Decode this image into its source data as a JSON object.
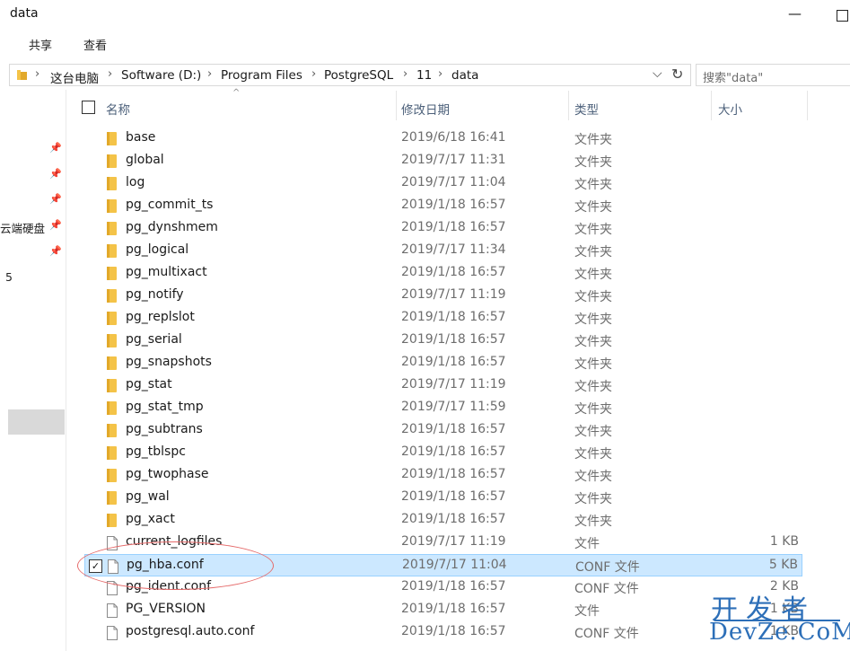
{
  "window": {
    "title": "data",
    "minimize_glyph": "—",
    "maximize_glyph": ""
  },
  "ribbon": {
    "tabs": [
      "共享",
      "查看"
    ]
  },
  "address": {
    "crumbs": [
      "这台电脑",
      "Software (D:)",
      "Program Files",
      "PostgreSQL",
      "11",
      "data"
    ],
    "separator": "›",
    "dropdown_glyph": "⌵",
    "refresh_glyph": "↻"
  },
  "search": {
    "placeholder": "搜索\"data\""
  },
  "nav": {
    "label1": "云端硬盘",
    "label2": "5",
    "pin_glyph": "📌"
  },
  "columns": {
    "name": "名称",
    "date": "修改日期",
    "type": "类型",
    "size": "大小",
    "sort_caret": "^"
  },
  "rows": [
    {
      "name": "base",
      "date": "2019/6/18 16:41",
      "type": "文件夹",
      "size": "",
      "kind": "folder"
    },
    {
      "name": "global",
      "date": "2019/7/17 11:31",
      "type": "文件夹",
      "size": "",
      "kind": "folder"
    },
    {
      "name": "log",
      "date": "2019/7/17 11:04",
      "type": "文件夹",
      "size": "",
      "kind": "folder"
    },
    {
      "name": "pg_commit_ts",
      "date": "2019/1/18 16:57",
      "type": "文件夹",
      "size": "",
      "kind": "folder"
    },
    {
      "name": "pg_dynshmem",
      "date": "2019/1/18 16:57",
      "type": "文件夹",
      "size": "",
      "kind": "folder"
    },
    {
      "name": "pg_logical",
      "date": "2019/7/17 11:34",
      "type": "文件夹",
      "size": "",
      "kind": "folder"
    },
    {
      "name": "pg_multixact",
      "date": "2019/1/18 16:57",
      "type": "文件夹",
      "size": "",
      "kind": "folder"
    },
    {
      "name": "pg_notify",
      "date": "2019/7/17 11:19",
      "type": "文件夹",
      "size": "",
      "kind": "folder"
    },
    {
      "name": "pg_replslot",
      "date": "2019/1/18 16:57",
      "type": "文件夹",
      "size": "",
      "kind": "folder"
    },
    {
      "name": "pg_serial",
      "date": "2019/1/18 16:57",
      "type": "文件夹",
      "size": "",
      "kind": "folder"
    },
    {
      "name": "pg_snapshots",
      "date": "2019/1/18 16:57",
      "type": "文件夹",
      "size": "",
      "kind": "folder"
    },
    {
      "name": "pg_stat",
      "date": "2019/7/17 11:19",
      "type": "文件夹",
      "size": "",
      "kind": "folder"
    },
    {
      "name": "pg_stat_tmp",
      "date": "2019/7/17 11:59",
      "type": "文件夹",
      "size": "",
      "kind": "folder"
    },
    {
      "name": "pg_subtrans",
      "date": "2019/1/18 16:57",
      "type": "文件夹",
      "size": "",
      "kind": "folder"
    },
    {
      "name": "pg_tblspc",
      "date": "2019/1/18 16:57",
      "type": "文件夹",
      "size": "",
      "kind": "folder"
    },
    {
      "name": "pg_twophase",
      "date": "2019/1/18 16:57",
      "type": "文件夹",
      "size": "",
      "kind": "folder"
    },
    {
      "name": "pg_wal",
      "date": "2019/1/18 16:57",
      "type": "文件夹",
      "size": "",
      "kind": "folder"
    },
    {
      "name": "pg_xact",
      "date": "2019/1/18 16:57",
      "type": "文件夹",
      "size": "",
      "kind": "folder"
    },
    {
      "name": "current_logfiles",
      "date": "2019/7/17 11:19",
      "type": "文件",
      "size": "1 KB",
      "kind": "file"
    },
    {
      "name": "pg_hba.conf",
      "date": "2019/7/17 11:04",
      "type": "CONF 文件",
      "size": "5 KB",
      "kind": "file",
      "selected": true
    },
    {
      "name": "pg_ident.conf",
      "date": "2019/1/18 16:57",
      "type": "CONF 文件",
      "size": "2 KB",
      "kind": "file"
    },
    {
      "name": "PG_VERSION",
      "date": "2019/1/18 16:57",
      "type": "文件",
      "size": "1 KB",
      "kind": "file"
    },
    {
      "name": "postgresql.auto.conf",
      "date": "2019/1/18 16:57",
      "type": "CONF 文件",
      "size": "1 KB",
      "kind": "file"
    }
  ],
  "watermark": {
    "cn": "开发者",
    "en": "DevZe.CoM",
    "color": "#2d6fb8"
  },
  "colors": {
    "folder": "#f4c348",
    "selection": "#cce8ff",
    "header_text": "#4c607a"
  }
}
